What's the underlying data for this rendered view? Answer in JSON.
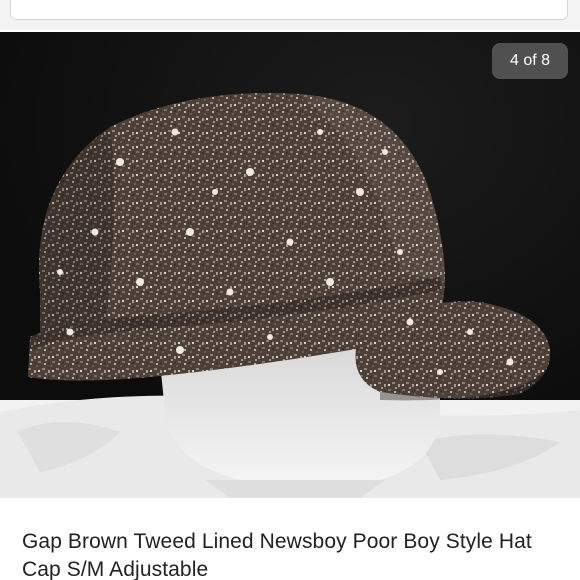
{
  "gallery": {
    "counter_label": "4 of 8"
  },
  "listing": {
    "title": "Gap Brown Tweed Lined Newsboy Poor Boy Style Hat Cap S/M Adjustable"
  },
  "photo": {
    "subject": "hat-photo",
    "colors": {
      "background": "#121212",
      "tweed_dark": "#4a3d34",
      "tweed_light": "#c9c2b8",
      "stand": "#e8e8e8"
    }
  }
}
